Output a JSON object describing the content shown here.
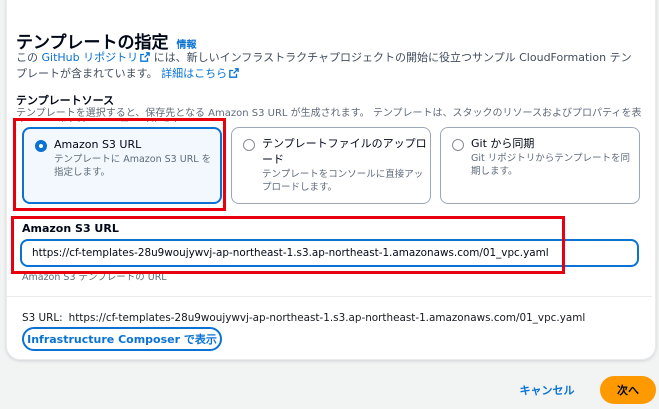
{
  "header": {
    "title": "テンプレートの指定",
    "info_link": "情報"
  },
  "description": {
    "part1": "この ",
    "github_link": "GitHub リポジトリ",
    "part2": " には、新しいインフラストラクチャプロジェクトの開始に役立つサンプル CloudFormation テンプレートが含まれています。 ",
    "details_link": "詳細はこちら"
  },
  "template_source": {
    "label": "テンプレートソース",
    "description": "テンプレートを選択すると、保存先となる Amazon S3 URL が生成されます。 テンプレートは、スタックのリソースおよびプロパティを表す JSON または YAML ファイルです。",
    "options": [
      {
        "title": "Amazon S3 URL",
        "description": "テンプレートに Amazon S3 URL を指定します。",
        "selected": true
      },
      {
        "title": "テンプレートファイルのアップロード",
        "description": "テンプレートをコンソールに直接アップロードします。",
        "selected": false
      },
      {
        "title": "Git から同期",
        "description": "Git リポジトリからテンプレートを同期します。",
        "selected": false
      }
    ]
  },
  "s3_url_field": {
    "label": "Amazon S3 URL",
    "value": "https://cf-templates-28u9woujywvj-ap-northeast-1.s3.ap-northeast-1.amazonaws.com/01_vpc.yaml",
    "hint": "Amazon S3 テンプレートの URL"
  },
  "s3_url_display": {
    "key": "S3 URL:",
    "value": "https://cf-templates-28u9woujywvj-ap-northeast-1.s3.ap-northeast-1.amazonaws.com/01_vpc.yaml"
  },
  "buttons": {
    "composer": "Infrastructure Composer で表示",
    "cancel": "キャンセル",
    "next": "次へ"
  },
  "colors": {
    "accent": "#0972d3",
    "primary_button": "#ff9900",
    "highlight": "#e8000f"
  }
}
